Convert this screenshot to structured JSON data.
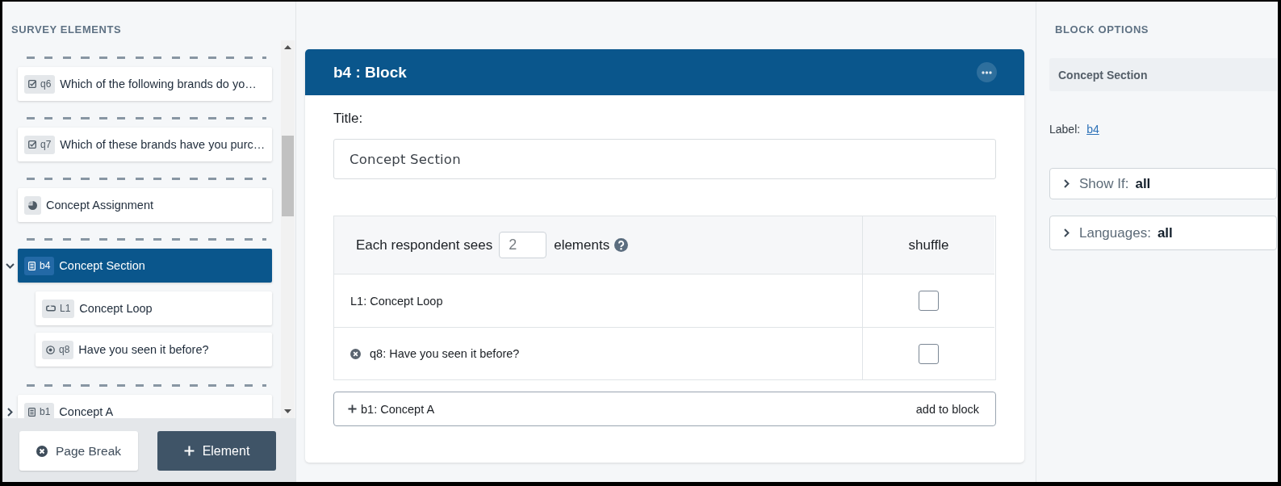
{
  "survey_elements": {
    "title": "SURVEY ELEMENTS",
    "items": [
      {
        "kind": "multi_select",
        "label": "q6",
        "text": "Which of the following brands do yo…",
        "page_break_before": true,
        "selected": false
      },
      {
        "kind": "multi_select",
        "label": "q7",
        "text": "Which of these brands have you purc…",
        "page_break_before": true,
        "selected": false
      },
      {
        "kind": "assignment",
        "text": "Concept Assignment",
        "page_break_before": true,
        "selected": false
      },
      {
        "kind": "block",
        "label": "b4",
        "text": "Concept Section",
        "page_break_before": true,
        "selected": true,
        "expanded": true,
        "children": [
          {
            "kind": "loop",
            "label": "L1",
            "text": "Concept Loop",
            "selected": false
          },
          {
            "kind": "single_select",
            "label": "q8",
            "text": "Have you seen it before?",
            "selected": false
          }
        ]
      },
      {
        "kind": "block",
        "label": "b1",
        "text": "Concept A",
        "page_break_before": true,
        "selected": false,
        "expanded": false
      }
    ],
    "buttons": [
      {
        "kind": "page_break",
        "label": "Page Break"
      },
      {
        "kind": "add_element",
        "label": "Element"
      }
    ]
  },
  "block_editor": {
    "title": "b4 : Block",
    "title_label": "Title:",
    "title_value": "Concept Section",
    "randomize": {
      "prefix": "Each respondent sees",
      "count": "2",
      "suffix": "elements",
      "shuffle_header": "shuffle"
    },
    "rows": [
      {
        "text": "L1: Concept Loop",
        "removable": false,
        "shuffle": false
      },
      {
        "text": "q8: Have you seen it before?",
        "removable": true,
        "shuffle": false
      }
    ],
    "add_item": {
      "text": "b1: Concept A",
      "action": "add to block"
    }
  },
  "block_options": {
    "title": "BLOCK OPTIONS",
    "name": "Concept Section",
    "label_caption": "Label:",
    "label_value": "b4",
    "conditions": [
      {
        "name": "Show If:",
        "value": "all",
        "expanded": false
      },
      {
        "name": "Languages:",
        "value": "all",
        "expanded": false
      }
    ]
  }
}
